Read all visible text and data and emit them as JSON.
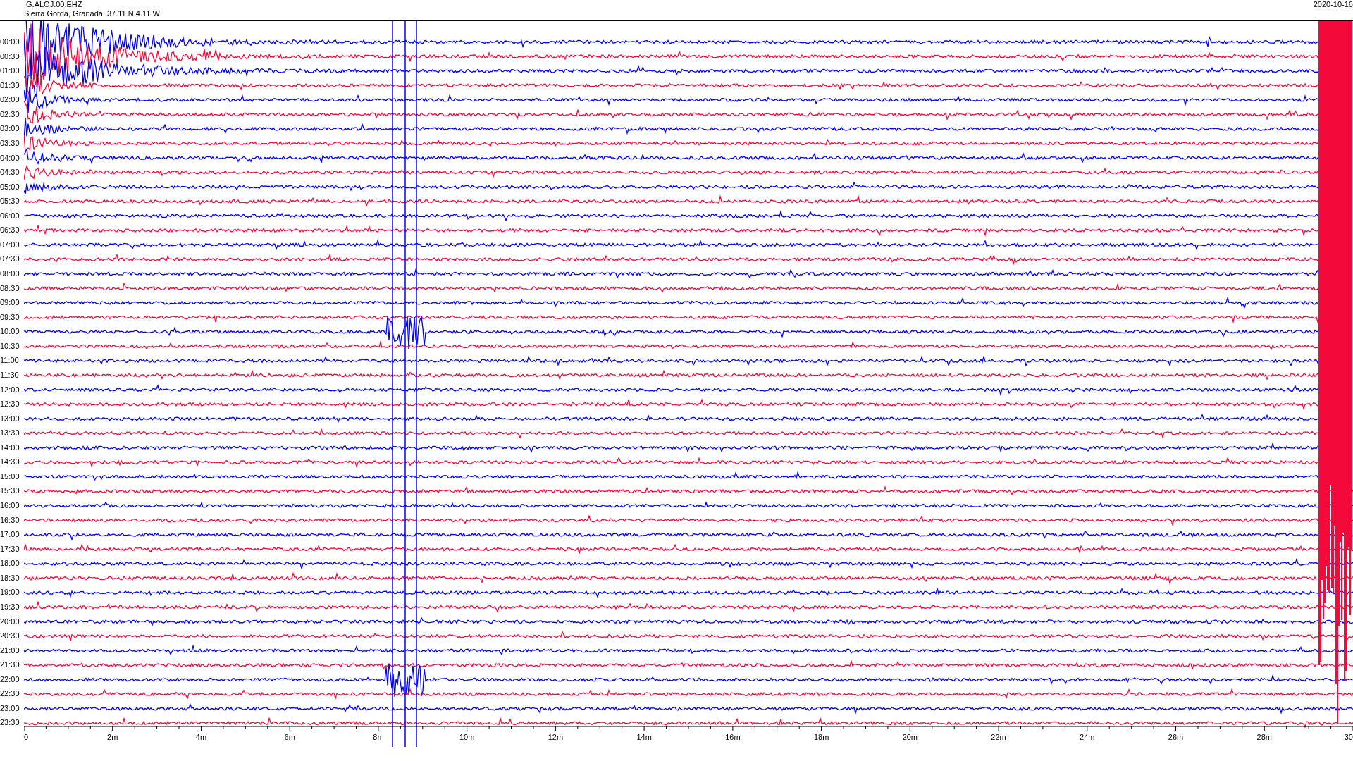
{
  "header": {
    "station": "IG.ALOJ.00.EHZ",
    "location": "Sierra Gorda, Granada  37.11 N 4.11 W",
    "date": "2020-10-16"
  },
  "rows": [
    {
      "time": "00:00",
      "color": "#0000ff"
    },
    {
      "time": "00:30",
      "color": "#f40a3a"
    },
    {
      "time": "01:00",
      "color": "#0000ff"
    },
    {
      "time": "01:30",
      "color": "#f40a3a"
    },
    {
      "time": "02:00",
      "color": "#0000ff"
    },
    {
      "time": "02:30",
      "color": "#f40a3a"
    },
    {
      "time": "03:00",
      "color": "#0000ff"
    },
    {
      "time": "03:30",
      "color": "#f40a3a"
    },
    {
      "time": "04:00",
      "color": "#0000ff"
    },
    {
      "time": "04:30",
      "color": "#f40a3a"
    },
    {
      "time": "05:00",
      "color": "#0000ff"
    },
    {
      "time": "05:30",
      "color": "#f40a3a"
    },
    {
      "time": "06:00",
      "color": "#0000ff"
    },
    {
      "time": "06:30",
      "color": "#f40a3a"
    },
    {
      "time": "07:00",
      "color": "#0000ff"
    },
    {
      "time": "07:30",
      "color": "#f40a3a"
    },
    {
      "time": "08:00",
      "color": "#0000ff"
    },
    {
      "time": "08:30",
      "color": "#f40a3a"
    },
    {
      "time": "09:00",
      "color": "#0000ff"
    },
    {
      "time": "09:30",
      "color": "#f40a3a"
    },
    {
      "time": "10:00",
      "color": "#0000ff"
    },
    {
      "time": "10:30",
      "color": "#f40a3a"
    },
    {
      "time": "11:00",
      "color": "#0000ff"
    },
    {
      "time": "11:30",
      "color": "#f40a3a"
    },
    {
      "time": "12:00",
      "color": "#0000ff"
    },
    {
      "time": "12:30",
      "color": "#f40a3a"
    },
    {
      "time": "13:00",
      "color": "#0000ff"
    },
    {
      "time": "13:30",
      "color": "#f40a3a"
    },
    {
      "time": "14:00",
      "color": "#0000ff"
    },
    {
      "time": "14:30",
      "color": "#f40a3a"
    },
    {
      "time": "15:00",
      "color": "#0000ff"
    },
    {
      "time": "15:30",
      "color": "#f40a3a"
    },
    {
      "time": "16:00",
      "color": "#0000ff"
    },
    {
      "time": "16:30",
      "color": "#f40a3a"
    },
    {
      "time": "17:00",
      "color": "#0000ff"
    },
    {
      "time": "17:30",
      "color": "#f40a3a"
    },
    {
      "time": "18:00",
      "color": "#0000ff"
    },
    {
      "time": "18:30",
      "color": "#f40a3a"
    },
    {
      "time": "19:00",
      "color": "#0000ff"
    },
    {
      "time": "19:30",
      "color": "#f40a3a"
    },
    {
      "time": "20:00",
      "color": "#0000ff"
    },
    {
      "time": "20:30",
      "color": "#f40a3a"
    },
    {
      "time": "21:00",
      "color": "#0000ff"
    },
    {
      "time": "21:30",
      "color": "#f40a3a"
    },
    {
      "time": "22:00",
      "color": "#0000ff"
    },
    {
      "time": "22:30",
      "color": "#f40a3a"
    },
    {
      "time": "23:00",
      "color": "#0000ff"
    },
    {
      "time": "23:30",
      "color": "#f40a3a"
    }
  ],
  "x_axis": {
    "ticks": [
      "0",
      "2m",
      "4m",
      "6m",
      "8m",
      "10m",
      "12m",
      "14m",
      "16m",
      "18m",
      "20m",
      "22m",
      "24m",
      "26m",
      "28m",
      "30"
    ]
  }
}
